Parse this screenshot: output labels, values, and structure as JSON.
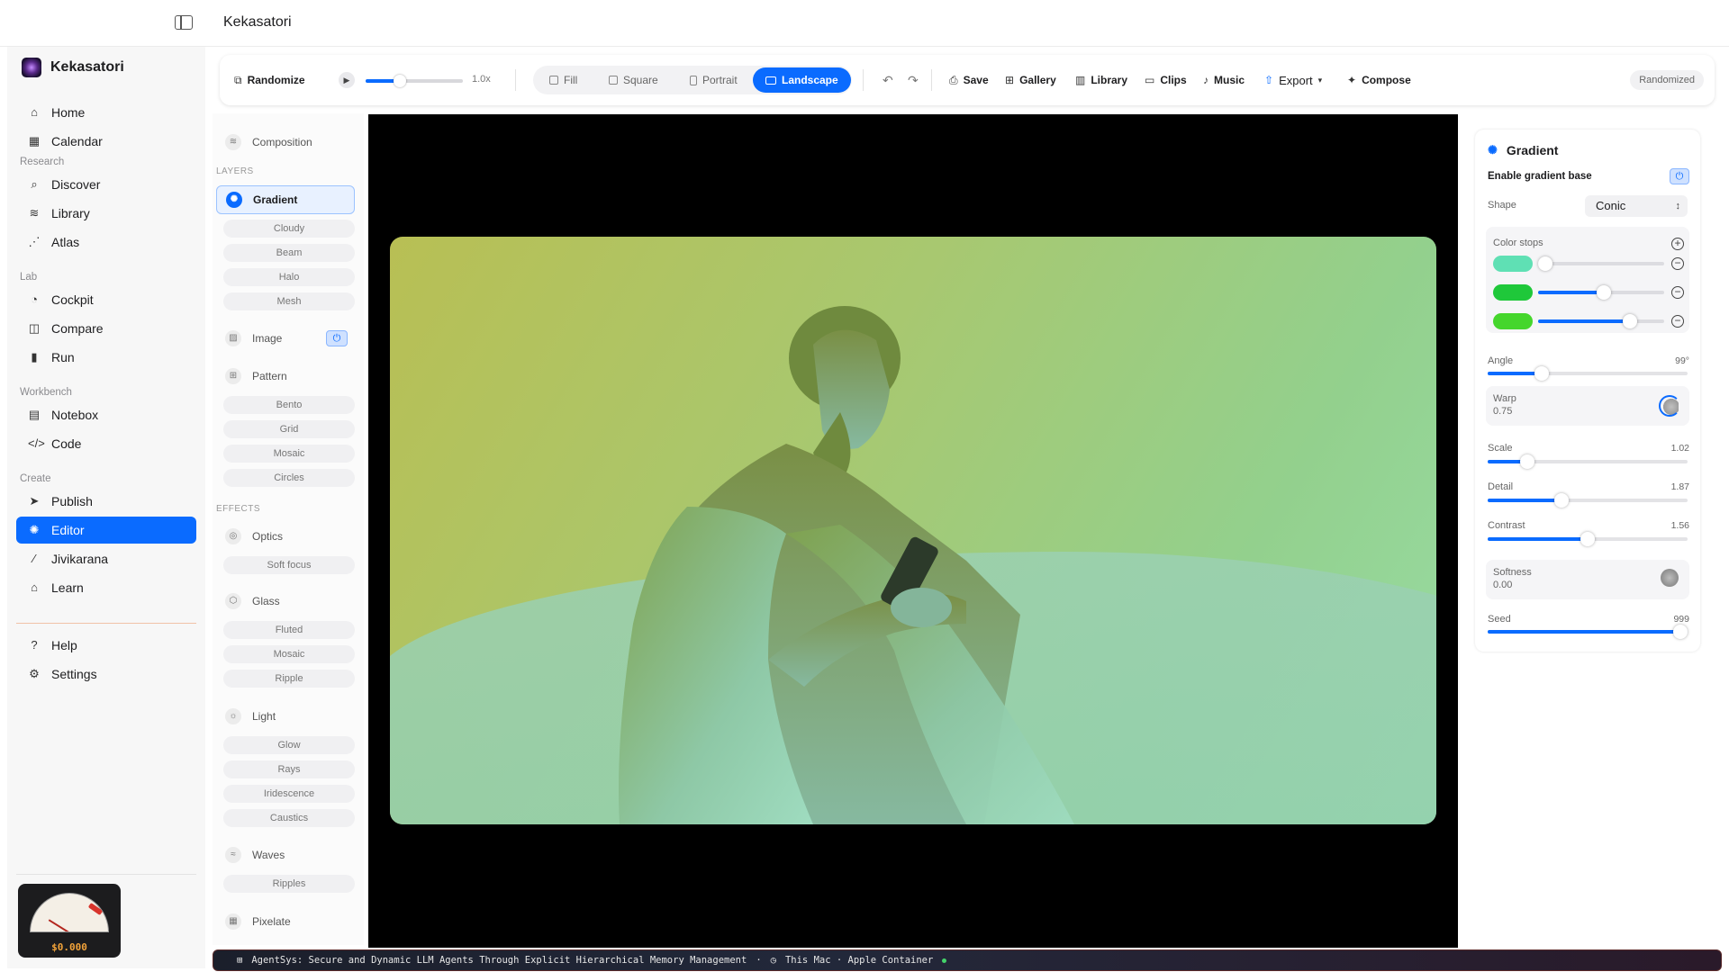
{
  "window": {
    "title": "Kekasatori"
  },
  "sidebar": {
    "brand": "Kekasatori",
    "top_items": [
      {
        "label": "Home",
        "icon": "home-icon"
      },
      {
        "label": "Calendar",
        "icon": "calendar-icon"
      }
    ],
    "sections": [
      {
        "title": "Research",
        "items": [
          "Discover",
          "Library",
          "Atlas"
        ]
      },
      {
        "title": "Lab",
        "items": [
          "Cockpit",
          "Compare",
          "Run"
        ]
      },
      {
        "title": "Workbench",
        "items": [
          "Notebox",
          "Code"
        ]
      },
      {
        "title": "Create",
        "items": [
          "Publish",
          "Editor",
          "Jivikarana",
          "Learn"
        ]
      }
    ],
    "active_item": "Editor",
    "bottom_items": [
      "Help",
      "Settings"
    ],
    "cost_gauge": {
      "value": "$0.000"
    }
  },
  "toolbar": {
    "randomize": "Randomize",
    "speed": "1.0x",
    "playback_progress": 0.35,
    "aspect": [
      "Fill",
      "Square",
      "Portrait",
      "Landscape"
    ],
    "aspect_active": "Landscape",
    "actions": [
      "Save",
      "Gallery",
      "Library",
      "Clips",
      "Music",
      "Export",
      "Compose"
    ],
    "status_badge": "Randomized"
  },
  "layers": {
    "composition": "Composition",
    "section_layers": "LAYERS",
    "gradient": "Gradient",
    "gradient_subs": [
      "Cloudy",
      "Beam",
      "Halo",
      "Mesh"
    ],
    "image": "Image",
    "pattern": "Pattern",
    "pattern_subs": [
      "Bento",
      "Grid",
      "Mosaic",
      "Circles"
    ],
    "section_effects": "EFFECTS",
    "optics": "Optics",
    "optics_subs": [
      "Soft focus"
    ],
    "glass": "Glass",
    "glass_subs": [
      "Fluted",
      "Mosaic",
      "Ripple"
    ],
    "light": "Light",
    "light_subs": [
      "Glow",
      "Rays",
      "Iridescence",
      "Caustics"
    ],
    "waves": "Waves",
    "waves_subs": [
      "Ripples"
    ],
    "pixelate": "Pixelate"
  },
  "properties": {
    "title": "Gradient",
    "enable_label": "Enable gradient base",
    "shape_label": "Shape",
    "shape_value": "Conic",
    "color_stops_label": "Color stops",
    "color_stops": [
      {
        "color": "#5fe0b4",
        "position": 0.05
      },
      {
        "color": "#1fc83a",
        "position": 0.52
      },
      {
        "color": "#45d62c",
        "position": 0.73
      }
    ],
    "angle": {
      "label": "Angle",
      "value": "99°",
      "fraction": 0.27
    },
    "warp": {
      "label": "Warp",
      "value": "0.75"
    },
    "scale": {
      "label": "Scale",
      "value": "1.02",
      "fraction": 0.2
    },
    "detail": {
      "label": "Detail",
      "value": "1.87",
      "fraction": 0.37
    },
    "contrast": {
      "label": "Contrast",
      "value": "1.56",
      "fraction": 0.5
    },
    "softness": {
      "label": "Softness",
      "value": "0.00"
    },
    "seed": {
      "label": "Seed",
      "value": "999",
      "fraction": 1.0
    }
  },
  "footer": {
    "title": "AgentSys: Secure and Dynamic LLM Agents Through Explicit Hierarchical Memory Management",
    "host": "This Mac · Apple Container"
  },
  "colors": {
    "accent": "#0a6bff",
    "status_ok": "#44d36a"
  }
}
